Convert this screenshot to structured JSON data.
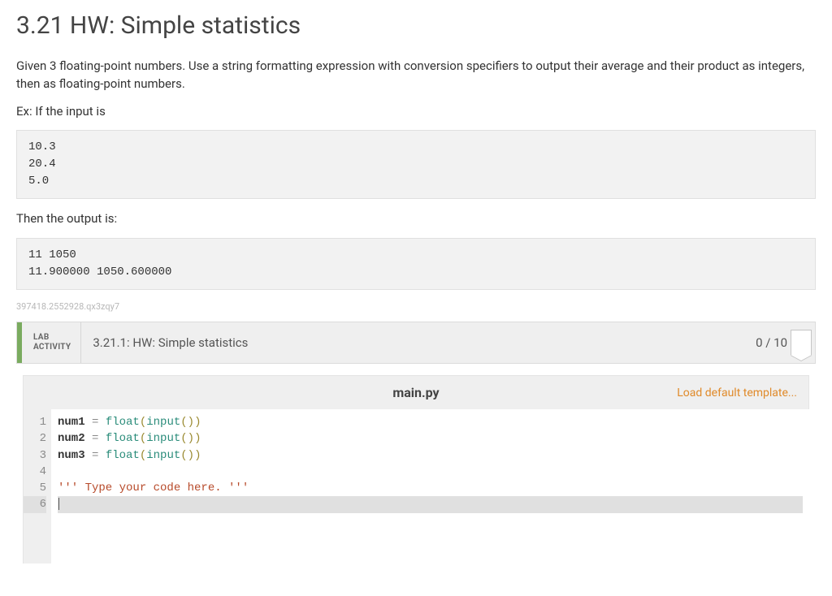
{
  "title": "3.21 HW: Simple statistics",
  "paragraph_1": "Given 3 floating-point numbers. Use a string formatting expression with conversion specifiers to output their average and their product as integers, then as floating-point numbers.",
  "ex_prefix": "Ex: If the input is",
  "input_block": "10.3\n20.4\n5.0",
  "output_prefix": "Then the output is:",
  "output_block": "11 1050\n11.900000 1050.600000",
  "hash_label": "397418.2552928.qx3zqy7",
  "lab": {
    "label_top": "LAB",
    "label_bottom": "ACTIVITY",
    "title": "3.21.1: HW: Simple statistics",
    "score": "0 / 10"
  },
  "editor": {
    "filename": "main.py",
    "load_template": "Load default template...",
    "lines": [
      {
        "n": "1",
        "raw": "num1 = float(input())",
        "tokens": [
          [
            "id",
            "num1"
          ],
          [
            "sp",
            " "
          ],
          [
            "op",
            "="
          ],
          [
            "sp",
            " "
          ],
          [
            "fn",
            "float"
          ],
          [
            "pn",
            "("
          ],
          [
            "fn",
            "input"
          ],
          [
            "pn",
            "("
          ],
          [
            "pn",
            ")"
          ],
          [
            "pn",
            ")"
          ]
        ]
      },
      {
        "n": "2",
        "raw": "num2 = float(input())",
        "tokens": [
          [
            "id",
            "num2"
          ],
          [
            "sp",
            " "
          ],
          [
            "op",
            "="
          ],
          [
            "sp",
            " "
          ],
          [
            "fn",
            "float"
          ],
          [
            "pn",
            "("
          ],
          [
            "fn",
            "input"
          ],
          [
            "pn",
            "("
          ],
          [
            "pn",
            ")"
          ],
          [
            "pn",
            ")"
          ]
        ]
      },
      {
        "n": "3",
        "raw": "num3 = float(input())",
        "tokens": [
          [
            "id",
            "num3"
          ],
          [
            "sp",
            " "
          ],
          [
            "op",
            "="
          ],
          [
            "sp",
            " "
          ],
          [
            "fn",
            "float"
          ],
          [
            "pn",
            "("
          ],
          [
            "fn",
            "input"
          ],
          [
            "pn",
            "("
          ],
          [
            "pn",
            ")"
          ],
          [
            "pn",
            ")"
          ]
        ]
      },
      {
        "n": "4",
        "raw": "",
        "tokens": []
      },
      {
        "n": "5",
        "raw": "''' Type your code here. '''",
        "tokens": [
          [
            "str",
            "''' Type your code here. '''"
          ]
        ]
      },
      {
        "n": "6",
        "raw": "",
        "tokens": [],
        "highlight": true,
        "cursor": true
      }
    ]
  }
}
